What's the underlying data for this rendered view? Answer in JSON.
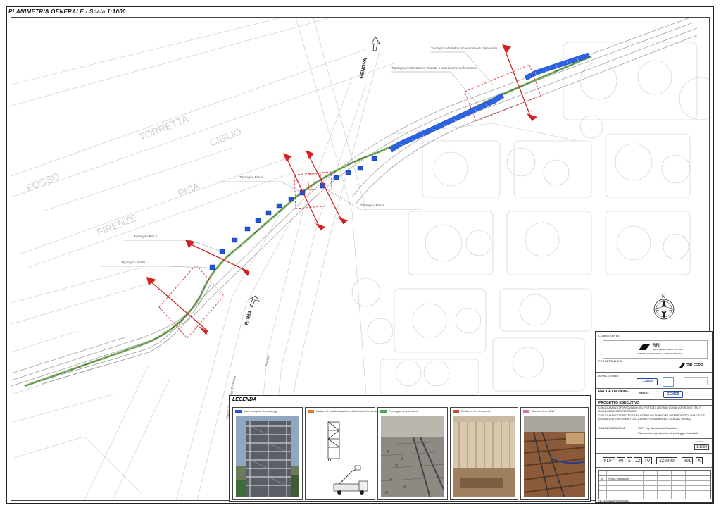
{
  "title": "PLANIMETRIA GENERALE - Scala 1:1000",
  "map": {
    "street_labels": [
      "FOSSO",
      "TORRETTA",
      "PISA",
      "FIRENZE",
      "CIGLIO"
    ],
    "direction_genova": "GENOVA",
    "direction_roma": "ROMA",
    "annotations": [
      "Tipologico Viadotto a scavalcamento ferroviario",
      "Tipologico realizzazione Viadotto a scavalcamento ferroviario",
      "Tipologico Pila 6",
      "Tipologico Pila 5",
      "Tipologico Pila 4",
      "Tipologico Spalla"
    ],
    "vertical_texts": [
      "Fascio Binari Fase Tirrenica",
      "Fascio"
    ],
    "north_label": "N"
  },
  "legend": {
    "title": "LEGENDA",
    "items": [
      {
        "label": "Aree occupate da ponteggi",
        "color": "#1f55d6"
      },
      {
        "label": "Utilizzo di trabattelli/autoelevatrici mobili in parete mobile",
        "color": "#e07a2a"
      },
      {
        "label": "Ponteggio di protezione",
        "color": "#4aa84a"
      },
      {
        "label": "Rettifiche in estradosso",
        "color": "#c0503a"
      },
      {
        "label": "Barriere tipo NCW",
        "color": "#d070b0"
      }
    ]
  },
  "titleblock": {
    "committente": "COMMITTENTE:",
    "rfi_name": "RFI",
    "rfi_sub": "RETE FERROVIARIA ITALIANA",
    "rfi_group": "GRUPPO FERROVIE DELLO STATO ITALIANE",
    "progettazione_label": "PROGETTAZIONE:",
    "italferr": "ITALFERR",
    "appaltatore": "APPALTATORE:",
    "cemes": "CEMES",
    "progettazione": "PROGETTAZIONE",
    "smart": "SMART",
    "cemes2": "CEMES",
    "progetto": "PROGETTO ESECUTIVO",
    "desc1": "COLLEGAMENTO FERROVIARIO DEL PORTO DI LIVORNO CON IL CORRIDOIO TEN-T SCANDINAVO-MEDITERRANEO",
    "desc2": "COLLEGAMENTO DIRETTO TRA IL PORTO DI LIVORNO E L'INTERPORTO DI GUASTICCE (SCAVALCO FERROVIARIO DELLA LINEA FONDAMENTALE GENOVA - ROMA)",
    "cantierizzazione": "CANTIERIZZAZIONE",
    "csp": "CSP: Ing. Alessandro Panattoni",
    "desc3": "Planimetria ingombramento ponteggi e trabattelli",
    "scala_label": "SCALA",
    "scala": "1:1000",
    "code": [
      "NL07",
      "00",
      "E",
      "ZZ",
      "P7",
      "SZ0000",
      "001",
      "A"
    ],
    "rev_row": [
      "A",
      "Prima emissione"
    ],
    "file": "File: NL0700EZZP7SZ0000001A"
  }
}
